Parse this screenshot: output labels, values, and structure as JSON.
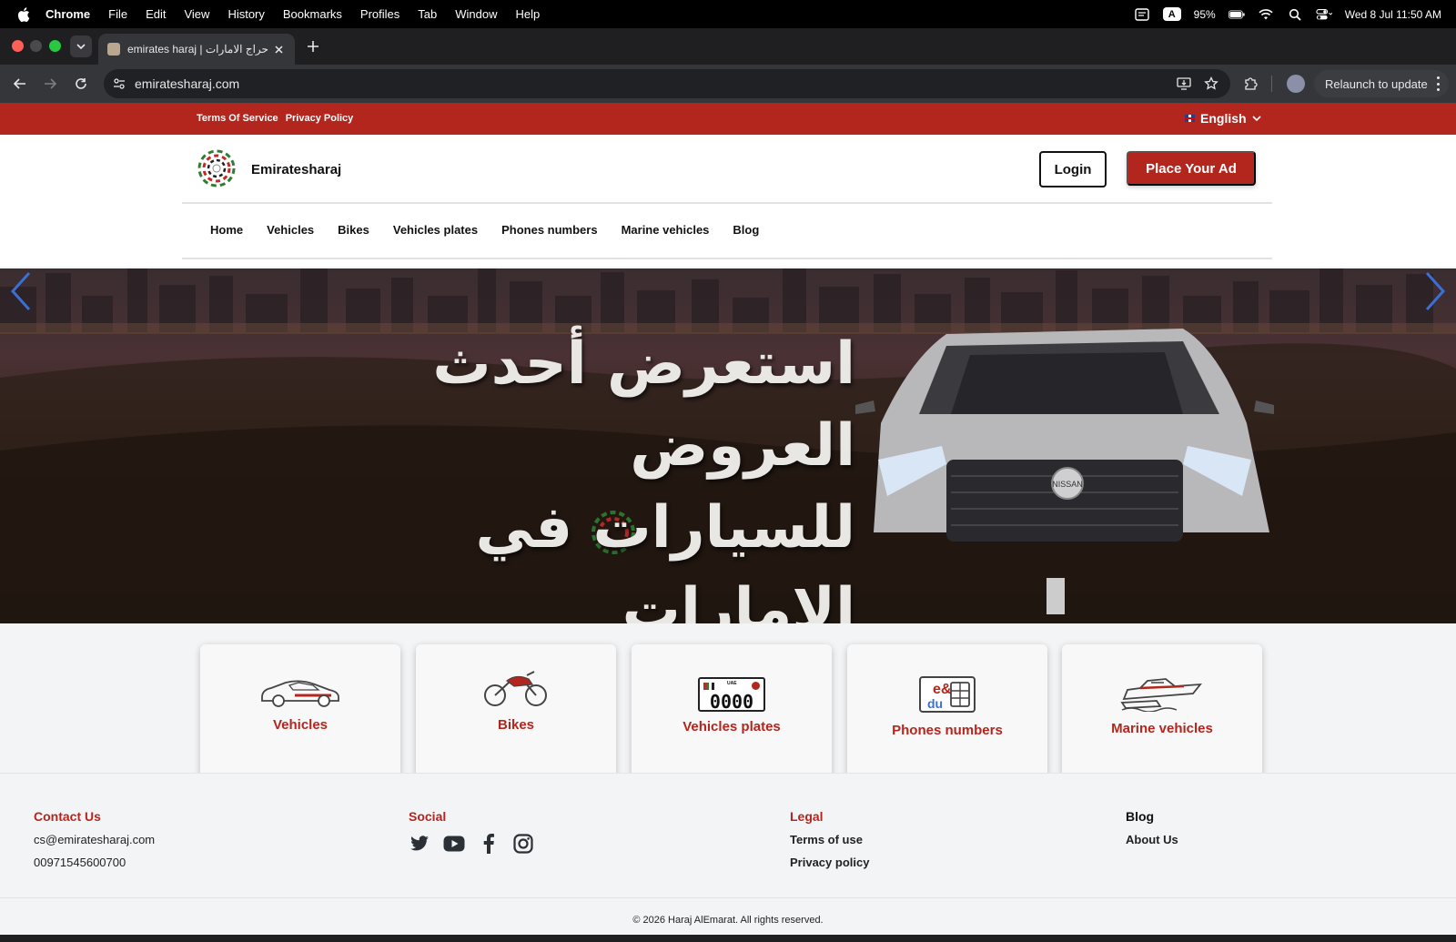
{
  "menubar": {
    "items": [
      "Chrome",
      "File",
      "Edit",
      "View",
      "History",
      "Bookmarks",
      "Profiles",
      "Tab",
      "Window",
      "Help"
    ],
    "battery": "95%",
    "datetime": "Wed 8 Jul  11:50 AM",
    "keyboard_badge": "A"
  },
  "browser": {
    "tab_title": "emirates haraj | حراج الامارات",
    "url": "emiratesharaj.com",
    "relaunch_label": "Relaunch to update"
  },
  "site": {
    "top_links": [
      "Terms Of Service",
      "Privacy Policy"
    ],
    "language": "English",
    "brand": "Emiratesharaj",
    "login": "Login",
    "place_ad": "Place Your Ad",
    "nav": [
      "Home",
      "Vehicles",
      "Bikes",
      "Vehicles plates",
      "Phones numbers",
      "Marine vehicles",
      "Blog"
    ],
    "hero": {
      "line1": "استعرض أحدث العروض",
      "line2": "للسيارات في الإمارات",
      "car_badge": "NISSAN",
      "plate_number": "0000",
      "plate_label": "UAE"
    },
    "categories": [
      {
        "label": "Vehicles",
        "icon": "car-icon"
      },
      {
        "label": "Bikes",
        "icon": "motorbike-icon"
      },
      {
        "label": "Vehicles plates",
        "icon": "license-plate-icon"
      },
      {
        "label": "Phones numbers",
        "icon": "sim-card-icon"
      },
      {
        "label": "Marine vehicles",
        "icon": "boat-icon"
      }
    ],
    "footer": {
      "contact_head": "Contact Us",
      "email": "cs@emiratesharaj.com",
      "phone": "00971545600700",
      "social_head": "Social",
      "social_icons": [
        "twitter-icon",
        "youtube-icon",
        "facebook-icon",
        "instagram-icon"
      ],
      "legal_head": "Legal",
      "terms": "Terms of use",
      "privacy": "Privacy policy",
      "blog": "Blog",
      "about": "About Us",
      "copyright": "© 2026 Haraj AlEmarat. All rights reserved."
    }
  },
  "colors": {
    "brand_red": "#b3261e",
    "browser_dark": "#35363a"
  }
}
